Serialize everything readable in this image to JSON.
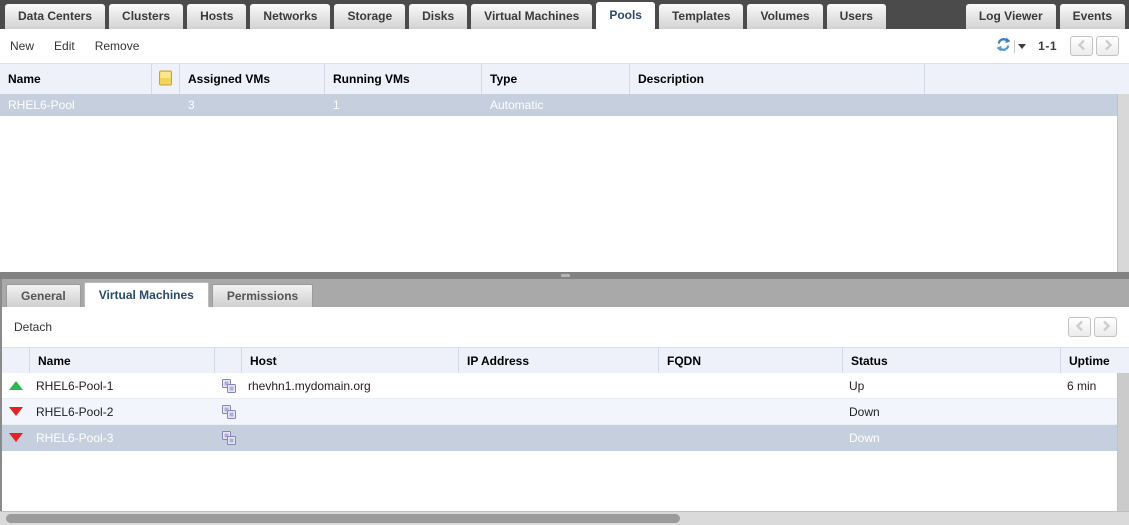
{
  "main_tabs": {
    "items": [
      {
        "label": "Data Centers",
        "active": false
      },
      {
        "label": "Clusters",
        "active": false
      },
      {
        "label": "Hosts",
        "active": false
      },
      {
        "label": "Networks",
        "active": false
      },
      {
        "label": "Storage",
        "active": false
      },
      {
        "label": "Disks",
        "active": false
      },
      {
        "label": "Virtual Machines",
        "active": false
      },
      {
        "label": "Pools",
        "active": true
      },
      {
        "label": "Templates",
        "active": false
      },
      {
        "label": "Volumes",
        "active": false
      },
      {
        "label": "Users",
        "active": false
      },
      {
        "label": "Log Viewer",
        "active": false
      },
      {
        "label": "Events",
        "active": false
      }
    ]
  },
  "toolbar": {
    "new_label": "New",
    "edit_label": "Edit",
    "remove_label": "Remove",
    "page_range": "1-1",
    "icons": [
      "refresh-icon",
      "caret-down-icon",
      "chevron-left-icon",
      "chevron-right-icon"
    ]
  },
  "pools_table": {
    "columns": {
      "name": "Name",
      "assigned_vms": "Assigned VMs",
      "running_vms": "Running VMs",
      "type": "Type",
      "description": "Description"
    },
    "icon_column": "note-icon",
    "rows": [
      {
        "name": "RHEL6-Pool",
        "assigned_vms": "3",
        "running_vms": "1",
        "type": "Automatic",
        "description": "",
        "selected": true
      }
    ]
  },
  "detail_tabs": {
    "items": [
      {
        "label": "General",
        "active": false
      },
      {
        "label": "Virtual Machines",
        "active": true
      },
      {
        "label": "Permissions",
        "active": false
      }
    ]
  },
  "detail_toolbar": {
    "detach_label": "Detach"
  },
  "vms_table": {
    "columns": {
      "name": "Name",
      "host": "Host",
      "ip": "IP Address",
      "fqdn": "FQDN",
      "status": "Status",
      "uptime": "Uptime"
    },
    "rows": [
      {
        "status_icon": "up",
        "name": "RHEL6-Pool-1",
        "host": "rhevhn1.mydomain.org",
        "ip": "",
        "fqdn": "",
        "status": "Up",
        "uptime": "6 min",
        "selected": false
      },
      {
        "status_icon": "down",
        "name": "RHEL6-Pool-2",
        "host": "",
        "ip": "",
        "fqdn": "",
        "status": "Down",
        "uptime": "",
        "selected": false
      },
      {
        "status_icon": "down",
        "name": "RHEL6-Pool-3",
        "host": "",
        "ip": "",
        "fqdn": "",
        "status": "Down",
        "uptime": "",
        "selected": true
      }
    ]
  },
  "colors": {
    "tabbar_bg": "#4b4b4b",
    "active_tab_text": "#2b4a6b",
    "table_header_bg": "#eef1fa",
    "selected_row_bg": "#c5cfdd",
    "alt_row_bg": "#f2f5fb",
    "status_up": "#2db84b",
    "status_down": "#e32222",
    "refresh_icon_blue": "#3d7fc4",
    "splitter": "#828282",
    "detail_tabbar_bg": "#a9a9a9",
    "scrollbar_thumb": "#9b9b9b"
  }
}
